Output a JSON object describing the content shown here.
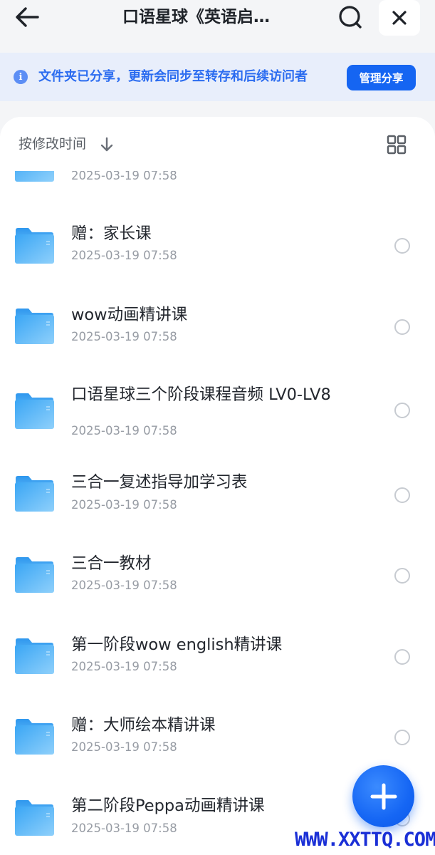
{
  "header": {
    "title": "口语星球《英语启…",
    "back_icon": "arrow-left-icon",
    "search_icon": "search-icon",
    "close_icon": "close-icon"
  },
  "banner": {
    "info_icon": "info-icon",
    "info_glyph": "i",
    "text": "文件夹已分享，更新会同步至转存和后续访问者",
    "manage_label": "管理分享"
  },
  "sort": {
    "label": "按修改时间",
    "arrow_icon": "arrow-down-icon",
    "view_icon": "grid-view-icon"
  },
  "items": [
    {
      "name": "",
      "date": "2025-03-19 07:58"
    },
    {
      "name": "赠：家长课",
      "date": "2025-03-19 07:58"
    },
    {
      "name": "wow动画精讲课",
      "date": "2025-03-19 07:58"
    },
    {
      "name": "口语星球三个阶段课程音频 LV0-LV8",
      "date": "2025-03-19 07:58"
    },
    {
      "name": "三合一复述指导加学习表",
      "date": "2025-03-19 07:58"
    },
    {
      "name": "三合一教材",
      "date": "2025-03-19 07:58"
    },
    {
      "name": "第一阶段wow english精讲课",
      "date": "2025-03-19 07:58"
    },
    {
      "name": "赠：大师绘本精讲课",
      "date": "2025-03-19 07:58"
    },
    {
      "name": "第二阶段Peppa动画精讲课",
      "date": "2025-03-19 07:58"
    }
  ],
  "fab": {
    "icon": "plus-icon"
  },
  "watermark": "WWW.XXTTQ.COM",
  "colors": {
    "accent": "#1565f2",
    "banner_bg": "#e8eefb",
    "banner_text": "#2b6cf0",
    "folder": "#4fb3f6"
  }
}
